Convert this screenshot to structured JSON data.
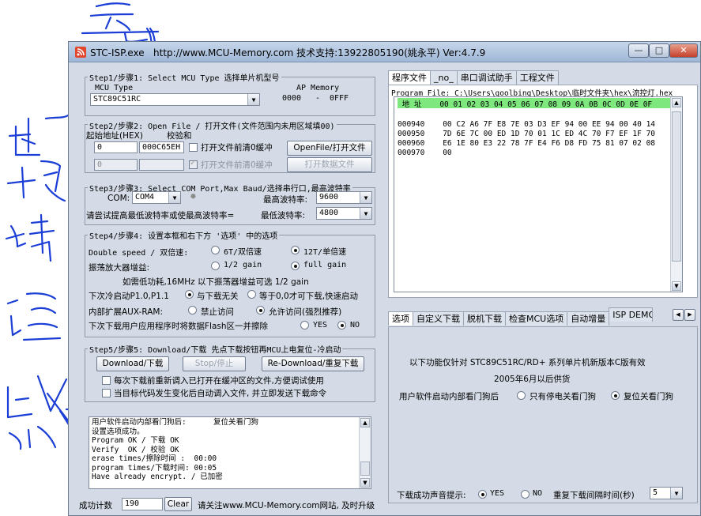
{
  "window": {
    "title": "STC-ISP.exe",
    "url_info": "http://www.MCU-Memory.com 技术支持:13922805190(姚永平) Ver:4.7.9",
    "min_icon": "minimize-icon",
    "max_icon": "maximize-icon",
    "close_icon": "close-icon"
  },
  "step1": {
    "title": "Step1/步骤1: Select MCU Type  选择单片机型号",
    "mcu_type_label": "MCU Type",
    "mcu_type_value": "STC89C51RC",
    "ap_memory_label": "AP Memory",
    "ap_from": "0000",
    "ap_dash": "-",
    "ap_to": "0FFF"
  },
  "step2": {
    "title": "Step2/步骤2: Open File / 打开文件(文件范围内未用区域填00)",
    "start_label": "起始地址(HEX)",
    "checksum_label": "校验和",
    "addr1": "0",
    "checksum1": "000C65EH",
    "clear_buf1": "打开文件前清0缓冲",
    "open_file": "OpenFile/打开文件",
    "addr2": "0",
    "checksum2": "",
    "clear_buf2": "打开文件前清0缓冲",
    "open_data": "打开数据文件"
  },
  "step3": {
    "title": "Step3/步骤3: Select COM Port,Max Baud/选择串行口,最高波特率",
    "com_label": "COM:",
    "com_value": "COM4",
    "max_baud_label": "最高波特率:",
    "max_baud_value": "9600",
    "hint": "请尝试提高最低波特率或使最高波特率=",
    "min_baud_label": "最低波特率:",
    "min_baud_value": "4800"
  },
  "step4": {
    "title": "Step4/步骤4: 设置本框和右下方 '选项' 中的选项",
    "double_speed_label": "Double speed / 双倍速:",
    "opt_6t": "6T/双倍速",
    "opt_12t": "12T/单倍速",
    "amp_label": "振荡放大器增益:",
    "opt_half": "1/2 gain",
    "opt_full": "full gain",
    "note": "如需低功耗,16MHz 以下振荡器增益可选 1/2 gain",
    "p10_label": "下次冷启动P1.0,P1.1",
    "opt_nocare": "与下载无关",
    "opt_eq0": "等于0,0才可下载,快速启动",
    "aux_label": "内部扩展AUX-RAM:",
    "opt_forbid": "禁止访问",
    "opt_allow": "允许访问(强烈推荐)",
    "erase_label": "下次下载用户应用程序时将数据Flash区一并擦除",
    "opt_yes": "YES",
    "opt_no": "NO"
  },
  "step5": {
    "title": "Step5/步骤5: Download/下载  先点下载按钮再MCU上电复位-冷启动",
    "download": "Download/下载",
    "stop": "Stop/停止",
    "redownload": "Re-Download/重复下载",
    "chk1": "每次下载前重新调入已打开在缓冲区的文件,方便调试使用",
    "chk2": "当目标代码发生变化后自动调入文件, 并立即发送下载命令"
  },
  "log": {
    "lines": [
      "用户软件启动内部看门狗后:      复位关看门狗",
      "设置选项成功。",
      "Program OK / 下载 OK",
      "Verify  OK / 校验 OK",
      "erase times/擦除时间 :  00:00",
      "program times/下载时间: 00:05",
      "Have already encrypt. / 已加密"
    ]
  },
  "status": {
    "count_label": "成功计数",
    "count_value": "190",
    "clear": "Clear",
    "notice": "请关注www.MCU-Memory.com网站, 及时升级"
  },
  "right_top": {
    "tabs": [
      "程序文件",
      "_no_",
      "串口调试助手",
      "工程文件"
    ],
    "file_label": "Program File: C:\\Users\\goolbing\\Desktop\\临时文件夹\\hex\\流控灯.hex",
    "header": " 地 址    00 01 02 03 04 05 06 07 08 09 0A 0B 0C 0D 0E 0F",
    "rows": [
      "000940    00 C2 A6 7F E8 7E 03 D3 EF 94 00 EE 94 00 40 14",
      "000950    7D 6E 7C 00 ED 1D 70 01 1C ED 4C 70 F7 EF 1F 70",
      "000960    E6 1E 80 E3 22 78 7F E4 F6 D8 FD 75 81 07 02 08",
      "000970    00"
    ]
  },
  "right_bottom": {
    "tabs": [
      "选项",
      "自定义下载",
      "脱机下载",
      "检查MCU选项",
      "自动增量",
      "ISP DEMO"
    ],
    "line1": "以下功能仅针对 STC89C51RC/RD+ 系列单片机新版本C版有效",
    "line2": "2005年6月以后供货",
    "wdt_label": "用户软件启动内部看门狗后",
    "opt_stop": "只有停电关看门狗",
    "opt_reset": "复位关看门狗",
    "sound_label": "下载成功声音提示:",
    "opt_yes": "YES",
    "opt_no": "NO",
    "interval_label": "重复下载间隔时间(秒)",
    "interval_value": "5"
  },
  "colors": {
    "window_bg": "#d4dbe6",
    "hex_header": "#7ee87e",
    "ink": "#1b3fd6"
  }
}
